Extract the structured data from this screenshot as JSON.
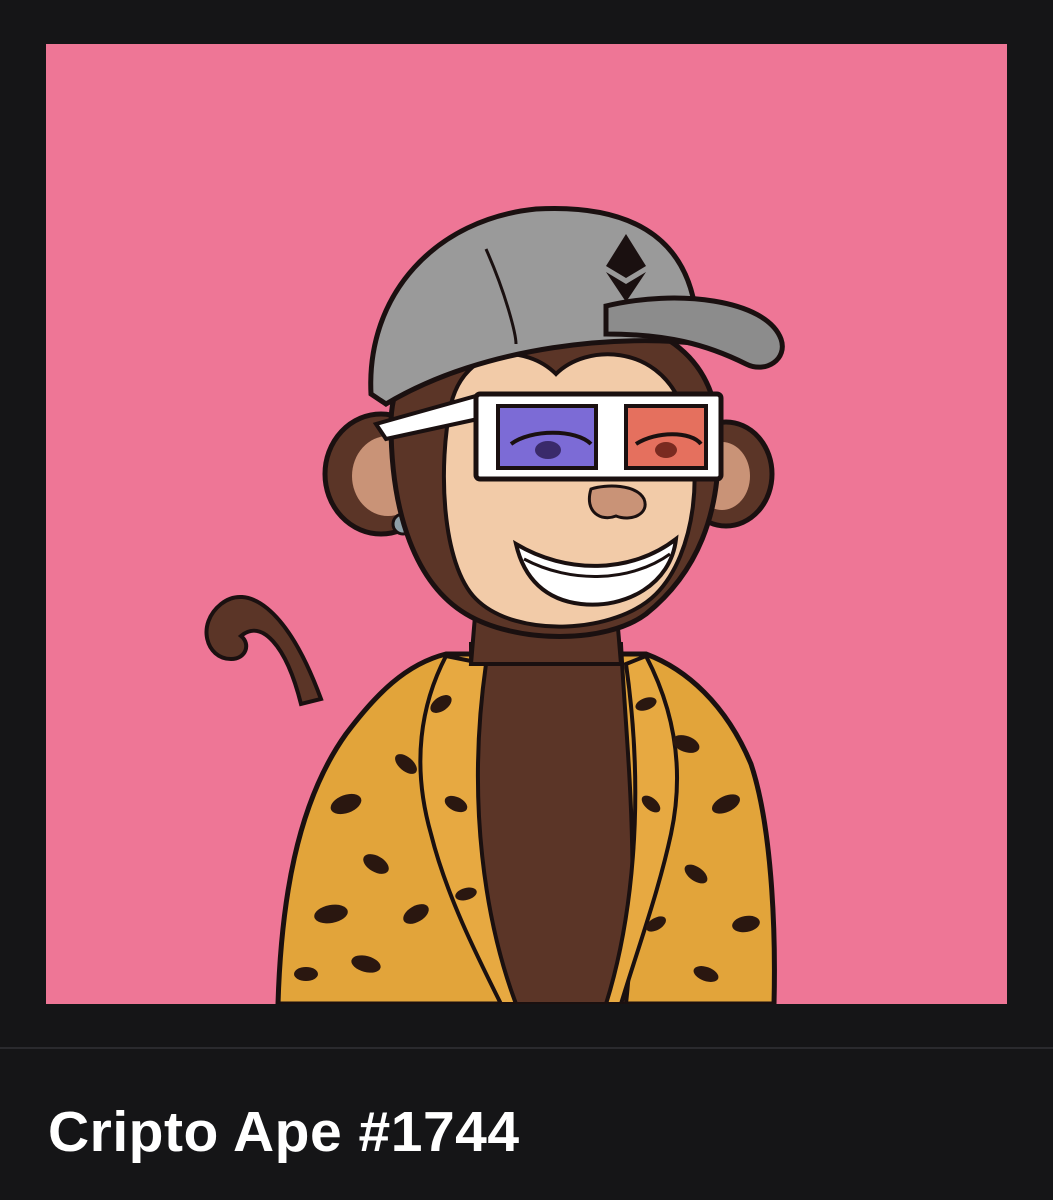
{
  "nft": {
    "title": "Cripto Ape #1744",
    "background_color": "#EE7696",
    "artwork_subject": "cartoon-ape",
    "traits": {
      "hat": "gray-cap-ethereum-logo",
      "eyewear": "3d-glasses",
      "earring": "silver-stud",
      "clothes": "leopard-print-jacket",
      "mouth": "grin"
    }
  },
  "colors": {
    "page_background": "#151517",
    "title_text": "#FFFFFF",
    "divider": "#2A2A2E"
  }
}
